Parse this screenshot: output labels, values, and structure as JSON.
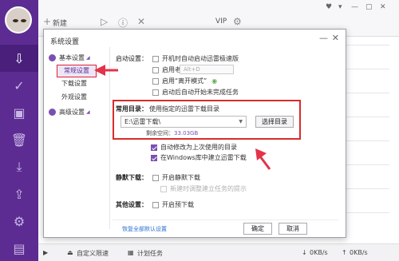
{
  "toolbar": {
    "new_label": "新建",
    "vip_label": "VIP"
  },
  "dialog": {
    "title": "系统设置",
    "nav": {
      "basic_group": "基本设置",
      "items": [
        "常规设置",
        "下载设置",
        "外观设置"
      ],
      "advanced_group": "高级设置"
    },
    "startup": {
      "label": "启动设置：",
      "options": [
        "开机时自动启动迅雷极速版",
        "启用老板键",
        "启用“离开模式”",
        "启动后自动开始未完成任务"
      ],
      "hotkey_placeholder": "Alt+D"
    },
    "dir": {
      "label": "常用目录：",
      "desc": "使用指定的迅雷下载目录",
      "value": "E:\\迅雷下载\\",
      "choose_button": "选择目录",
      "free_label": "剩余空间：",
      "free_value": "33.03GB",
      "auto_change": "自动修改为上次使用的目录",
      "create_dir": "在Windows库中建立迅雷下载"
    },
    "silent": {
      "label": "静默下载：",
      "option": "开启静默下载",
      "sub_option": "新建时调整建立任务的提示"
    },
    "other": {
      "label": "其他设置：",
      "option": "开启预下载"
    },
    "restore_link": "恢复全部默认设置",
    "ok_button": "确定",
    "cancel_button": "取消"
  },
  "statusbar": {
    "speed_limit": "自定义限速",
    "plan_task": "计划任务",
    "down_speed": "0KB/s",
    "up_speed": "0KB/s"
  }
}
